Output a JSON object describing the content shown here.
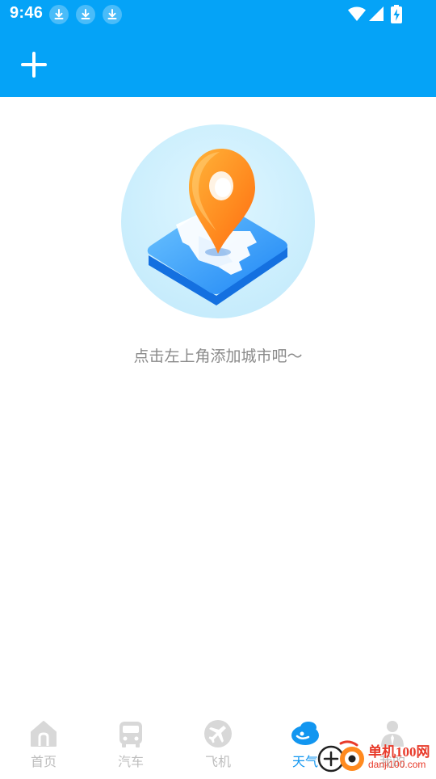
{
  "status_bar": {
    "time": "9:46",
    "icons": [
      "download-icon",
      "download-icon",
      "download-icon",
      "wifi-icon",
      "cellular-signal-icon",
      "battery-charging-icon"
    ]
  },
  "app_bar": {
    "add_icon": "plus-icon"
  },
  "empty_state": {
    "illustration": "location-pin-map-illustration",
    "message": "点击左上角添加城市吧～"
  },
  "bottom_nav": {
    "items": [
      {
        "label": "首页",
        "icon": "home-icon",
        "active": false
      },
      {
        "label": "汽车",
        "icon": "bus-icon",
        "active": false
      },
      {
        "label": "飞机",
        "icon": "airplane-icon",
        "active": false
      },
      {
        "label": "天气",
        "icon": "weather-cloud-icon",
        "active": true
      },
      {
        "label": "我的",
        "icon": "person-icon",
        "active": false
      }
    ]
  },
  "watermark": {
    "title": "单机100网",
    "url": "danji100.com"
  },
  "colors": {
    "primary": "#05a3f7",
    "active_tab": "#1296f0",
    "inactive_tab": "#bdbdbd",
    "pin_orange": "#ff8a1f"
  }
}
